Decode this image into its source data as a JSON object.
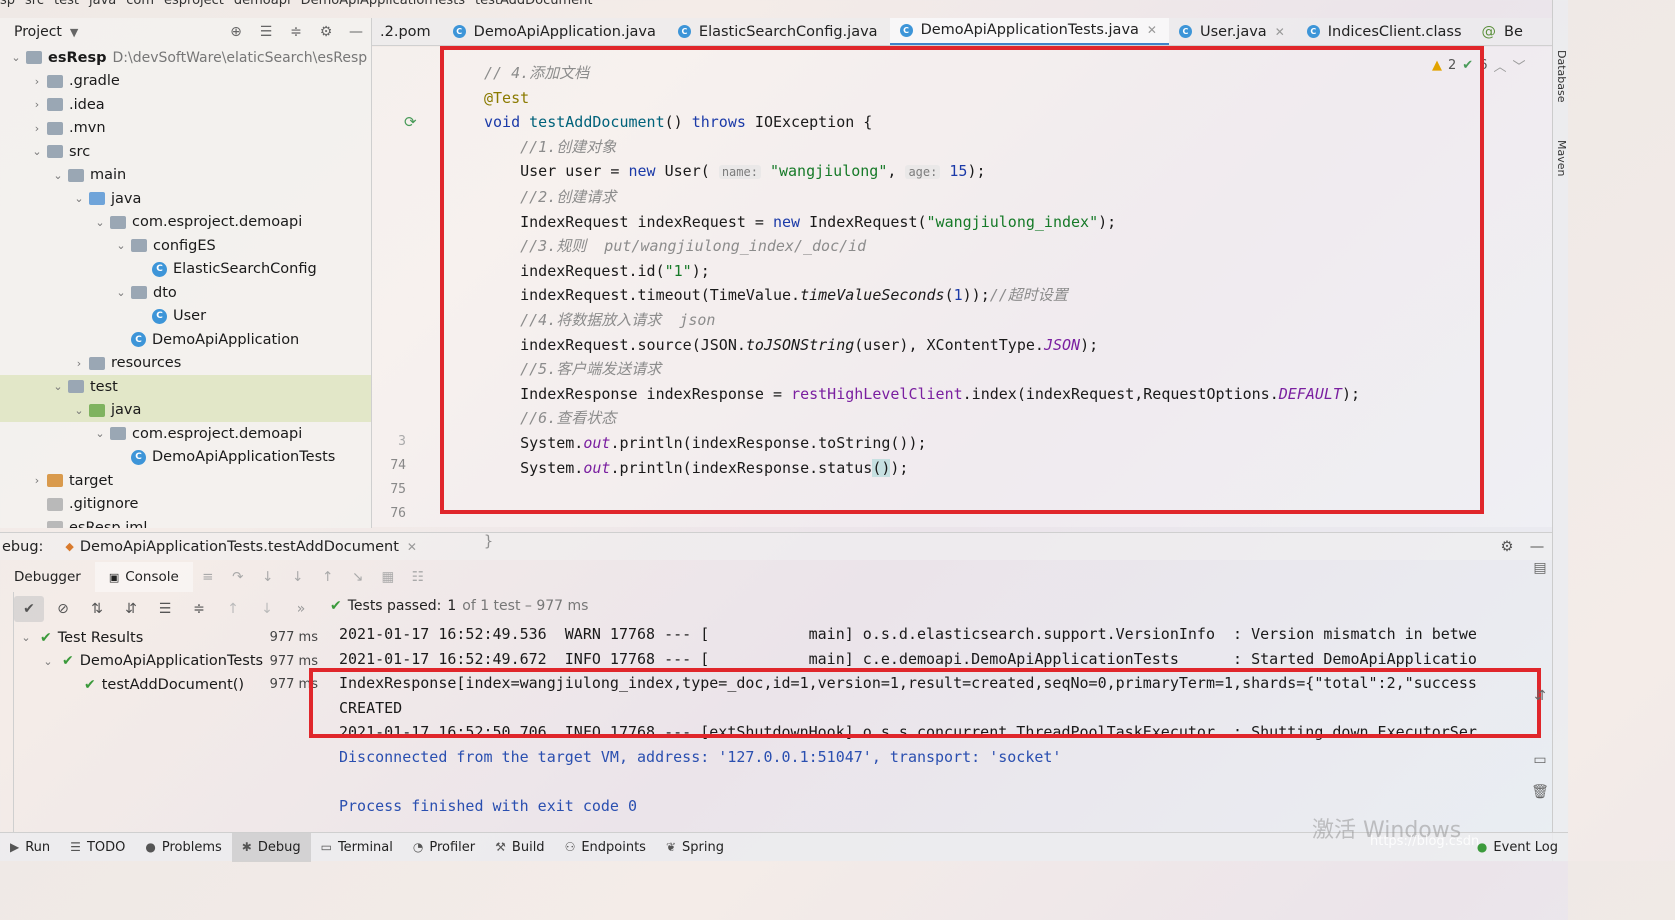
{
  "breadcrumb": [
    "sp",
    "src",
    "test",
    "java",
    "com",
    "esproject",
    "demoapi",
    "DemoApiApplicationTests",
    "testAddDocument"
  ],
  "run_config": "DemoApiApplicationTests.testAddDocument",
  "project": {
    "header": "Project",
    "root_name": "esResp",
    "root_path": "D:\\devSoftWare\\elaticSearch\\esResp",
    "items": [
      {
        "label": ".gradle",
        "indent": 1,
        "arrow": "›",
        "icon": "folder"
      },
      {
        "label": ".idea",
        "indent": 1,
        "arrow": "›",
        "icon": "folder"
      },
      {
        "label": ".mvn",
        "indent": 1,
        "arrow": "›",
        "icon": "folder"
      },
      {
        "label": "src",
        "indent": 1,
        "arrow": "⌄",
        "icon": "folder"
      },
      {
        "label": "main",
        "indent": 2,
        "arrow": "⌄",
        "icon": "folder"
      },
      {
        "label": "java",
        "indent": 3,
        "arrow": "⌄",
        "icon": "folder-blue"
      },
      {
        "label": "com.esproject.demoapi",
        "indent": 4,
        "arrow": "⌄",
        "icon": "folder"
      },
      {
        "label": "configES",
        "indent": 5,
        "arrow": "⌄",
        "icon": "folder"
      },
      {
        "label": "ElasticSearchConfig",
        "indent": 6,
        "arrow": "",
        "icon": "class"
      },
      {
        "label": "dto",
        "indent": 5,
        "arrow": "⌄",
        "icon": "folder"
      },
      {
        "label": "User",
        "indent": 6,
        "arrow": "",
        "icon": "class"
      },
      {
        "label": "DemoApiApplication",
        "indent": 5,
        "arrow": "",
        "icon": "class"
      },
      {
        "label": "resources",
        "indent": 3,
        "arrow": "›",
        "icon": "folder"
      },
      {
        "label": "test",
        "indent": 2,
        "arrow": "⌄",
        "icon": "folder"
      },
      {
        "label": "java",
        "indent": 3,
        "arrow": "⌄",
        "icon": "folder-green"
      },
      {
        "label": "com.esproject.demoapi",
        "indent": 4,
        "arrow": "⌄",
        "icon": "folder"
      },
      {
        "label": "DemoApiApplicationTests",
        "indent": 5,
        "arrow": "",
        "icon": "class"
      },
      {
        "label": "target",
        "indent": 1,
        "arrow": "›",
        "icon": "folder-orange"
      },
      {
        "label": ".gitignore",
        "indent": 1,
        "arrow": "",
        "icon": "file"
      },
      {
        "label": "esResp.iml",
        "indent": 1,
        "arrow": "",
        "icon": "file"
      }
    ]
  },
  "tabs": [
    {
      "label": ".2.pom",
      "icon": "none",
      "active": false
    },
    {
      "label": "DemoApiApplication.java",
      "icon": "class",
      "active": false
    },
    {
      "label": "ElasticSearchConfig.java",
      "icon": "class",
      "active": false
    },
    {
      "label": "DemoApiApplicationTests.java",
      "icon": "class",
      "active": true
    },
    {
      "label": "User.java",
      "icon": "class",
      "active": false
    },
    {
      "label": "IndicesClient.class",
      "icon": "class",
      "active": false
    },
    {
      "label": "Be",
      "icon": "at",
      "active": false
    }
  ],
  "editor": {
    "warnings": "2",
    "ok_count": "6",
    "line_numbers": [
      "74",
      "75",
      "76"
    ],
    "line3_stub": "3",
    "code": {
      "l1": "// 4.添加文档",
      "l2": "@Test",
      "l3_void": "void",
      "l3_name": "testAddDocument",
      "l3_mid": "() ",
      "l3_throws": "throws",
      "l3_rest": " IOException {",
      "l4": "//1.创建对象",
      "l5_a": "User user = ",
      "l5_new": "new",
      "l5_b": " User(",
      "l5_hint1": "name:",
      "l5_s1": "\"wangjiulong\"",
      "l5_c": ", ",
      "l5_hint2": "age:",
      "l5_n": "15",
      "l5_d": ");",
      "l6": "//2.创建请求",
      "l7_a": "IndexRequest indexRequest = ",
      "l7_new": "new",
      "l7_b": " IndexRequest(",
      "l7_s": "\"wangjiulong_index\"",
      "l7_c": ");",
      "l8": "//3.规则  put/wangjiulong_index/_doc/id",
      "l9_a": "indexRequest.id(",
      "l9_s": "\"1\"",
      "l9_b": ");",
      "l10_a": "indexRequest.timeout(TimeValue.",
      "l10_m": "timeValueSeconds",
      "l10_b": "(",
      "l10_n": "1",
      "l10_c": "));",
      "l10_cm": "//超时设置",
      "l11": "//4.将数据放入请求  json",
      "l12_a": "indexRequest.source(JSON.",
      "l12_m": "toJSONString",
      "l12_b": "(user), XContentType.",
      "l12_f": "JSON",
      "l12_c": ");",
      "l13": "//5.客户端发送请求",
      "l14_a": "IndexResponse indexResponse = ",
      "l14_f": "restHighLevelClient",
      "l14_b": ".index(indexRequest,RequestOptions.",
      "l14_d": "DEFAULT",
      "l14_c": ");",
      "l15": "//6.查看状态",
      "l16_a": "System.",
      "l16_out": "out",
      "l16_b": ".println(indexResponse.toString());",
      "l17_a": "System.",
      "l17_out": "out",
      "l17_b": ".println(indexResponse.status",
      "l17_p": "()",
      "l17_c": ");",
      "l18": "}"
    }
  },
  "debug": {
    "label": "ebug:",
    "config": "DemoApiApplicationTests.testAddDocument",
    "tabs": [
      "Debugger",
      "Console"
    ],
    "status_prefix": "Tests passed:",
    "status_count": "1",
    "status_rest": "of 1 test – 977 ms",
    "tree": [
      {
        "label": "Test Results",
        "time": "977 ms",
        "indent": 0
      },
      {
        "label": "DemoApiApplicationTests",
        "time": "977 ms",
        "indent": 1
      },
      {
        "label": "testAddDocument()",
        "time": "977 ms",
        "indent": 2
      }
    ],
    "console": [
      "2021-01-17 16:52:49.536  WARN 17768 --- [           main] o.s.d.elasticsearch.support.VersionInfo  : Version mismatch in betwe",
      "2021-01-17 16:52:49.672  INFO 17768 --- [           main] c.e.demoapi.DemoApiApplicationTests      : Started DemoApiApplicatio",
      "IndexResponse[index=wangjiulong_index,type=_doc,id=1,version=1,result=created,seqNo=0,primaryTerm=1,shards={\"total\":2,\"success",
      "CREATED",
      "2021-01-17 16:52:50.706  INFO 17768 --- [extShutdownHook] o.s.s.concurrent.ThreadPoolTaskExecutor  : Shutting down ExecutorSer",
      "Disconnected from the target VM, address: '127.0.0.1:51047', transport: 'socket'",
      "",
      "Process finished with exit code 0"
    ]
  },
  "right_strip": [
    "Database",
    "Maven"
  ],
  "bottom_bar": {
    "items": [
      "Run",
      "TODO",
      "Problems",
      "Debug",
      "Terminal",
      "Profiler",
      "Build",
      "Endpoints",
      "Spring"
    ],
    "event_log": "Event Log",
    "watermark": "激活 Windows",
    "blog": "https://blog.csdn"
  },
  "colors": {
    "highlight_box": "#e0262b",
    "keyword": "#1b3aa8",
    "string": "#167a28",
    "pass": "#3b9a3b"
  }
}
